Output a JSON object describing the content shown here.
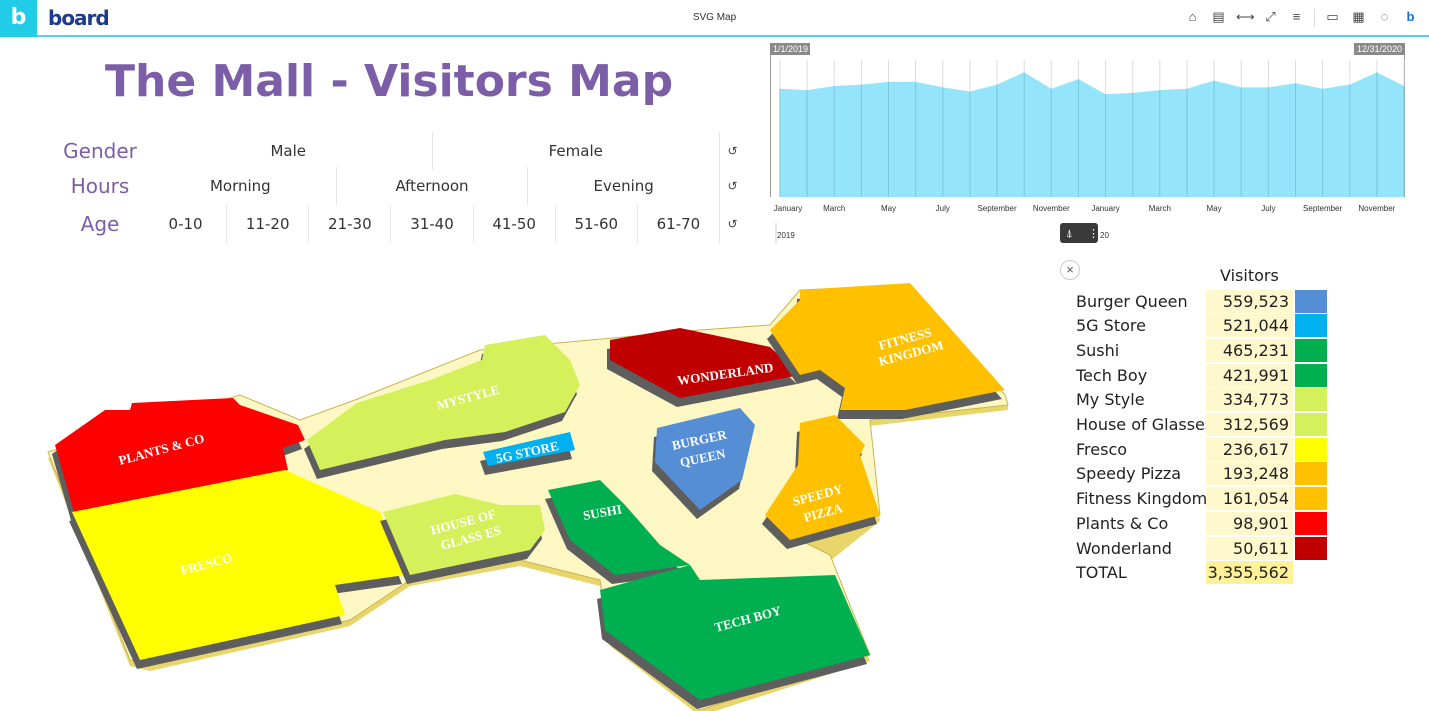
{
  "header": {
    "app_title": "SVG Map",
    "brand": "board",
    "logo_letter": "b",
    "tools": [
      "home-icon",
      "layout-icon",
      "fit-width-icon",
      "fullscreen-icon",
      "menu-icon",
      "notes-icon",
      "calculator-icon",
      "comment-icon",
      "board-icon"
    ]
  },
  "page_title": "The Mall - Visitors Map",
  "filters": [
    {
      "label": "Gender",
      "options": [
        "Male",
        "Female"
      ]
    },
    {
      "label": "Hours",
      "options": [
        "Morning",
        "Afternoon",
        "Evening"
      ]
    },
    {
      "label": "Age",
      "options": [
        "0-10",
        "11-20",
        "21-30",
        "31-40",
        "41-50",
        "51-60",
        "61-70"
      ]
    }
  ],
  "timeline": {
    "start_label": "1/1/2019",
    "end_label": "12/31/2020",
    "years": [
      "2019",
      "2020"
    ],
    "visible_year_fragment": "20",
    "fill": "#94e4fc"
  },
  "chart_data": {
    "type": "area",
    "x": [
      "Jan 2019",
      "Feb 2019",
      "Mar 2019",
      "Apr 2019",
      "May 2019",
      "Jun 2019",
      "Jul 2019",
      "Aug 2019",
      "Sep 2019",
      "Oct 2019",
      "Nov 2019",
      "Dec 2019",
      "Jan 2020",
      "Feb 2020",
      "Mar 2020",
      "Apr 2020",
      "May 2020",
      "Jun 2020",
      "Jul 2020",
      "Aug 2020",
      "Sep 2020",
      "Oct 2020",
      "Nov 2020",
      "Dec 2020"
    ],
    "values": [
      79,
      78,
      81,
      82,
      84,
      84,
      80,
      77,
      82,
      91,
      79,
      86,
      75,
      76,
      78,
      79,
      85,
      80,
      80,
      83,
      79,
      82,
      91,
      81
    ],
    "tick_labels": [
      "January",
      "March",
      "May",
      "July",
      "September",
      "November",
      "January",
      "March",
      "May",
      "July",
      "September",
      "November"
    ],
    "grid": true
  },
  "table": {
    "header": "Visitors",
    "rows": [
      {
        "name": "Burger Queen",
        "value": "559,523",
        "color": "#558ed5"
      },
      {
        "name": "5G Store",
        "value": "521,044",
        "color": "#00b0f0"
      },
      {
        "name": "Sushi",
        "value": "465,231",
        "color": "#00b050"
      },
      {
        "name": "Tech Boy",
        "value": "421,991",
        "color": "#00b050"
      },
      {
        "name": "My Style",
        "value": "334,773",
        "color": "#d4f05a"
      },
      {
        "name": "House of Glasses",
        "value": "312,569",
        "color": "#d4f05a"
      },
      {
        "name": "Fresco",
        "value": "236,617",
        "color": "#ffff00"
      },
      {
        "name": "Speedy Pizza",
        "value": "193,248",
        "color": "#ffc000"
      },
      {
        "name": "Fitness Kingdom",
        "value": "161,054",
        "color": "#ffc000"
      },
      {
        "name": "Plants & Co",
        "value": "98,901",
        "color": "#ff0000"
      },
      {
        "name": "Wonderland",
        "value": "50,611",
        "color": "#c00000"
      }
    ],
    "total_label": "TOTAL",
    "total_value": "3,355,562"
  },
  "map": {
    "labels": {
      "plants": "PLANTS & CO",
      "fresco": "FRESCO",
      "mystyle": "MYSTYLE",
      "glasses1": "HOUSE OF",
      "glasses2": "GLASS ES",
      "g5": "5G STORE",
      "wonder": "WONDERLAND",
      "fitness1": "FITNESS",
      "fitness2": "KINGDOM",
      "burger1": "BURGER",
      "burger2": "QUEEN",
      "pizza1": "SPEEDY",
      "pizza2": "PIZZA",
      "sushi": "SUSHI",
      "techboy": "TECH BOY"
    }
  }
}
